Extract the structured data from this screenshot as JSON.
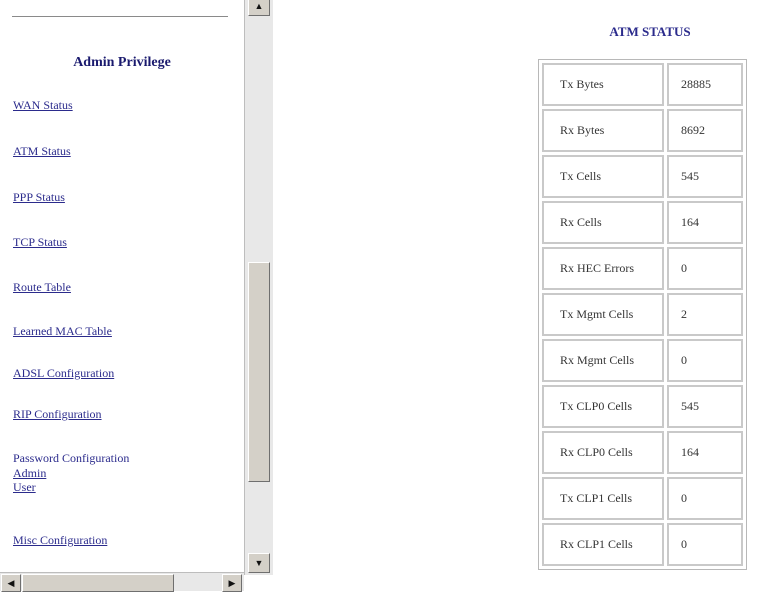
{
  "menu": {
    "title": "Admin Privilege",
    "links": [
      {
        "id": "wan",
        "label": "WAN Status"
      },
      {
        "id": "atm",
        "label": "ATM Status"
      },
      {
        "id": "ppp",
        "label": "PPP Status"
      },
      {
        "id": "tcp",
        "label": "TCP Status"
      },
      {
        "id": "route",
        "label": "Route Table"
      },
      {
        "id": "mac",
        "label": "Learned MAC Table"
      },
      {
        "id": "adsl",
        "label": "ADSL Configuration"
      },
      {
        "id": "rip",
        "label": "RIP Configuration"
      }
    ],
    "password_config_label": "Password Configuration",
    "password_admin": "Admin",
    "password_user": "User",
    "misc_label": "Misc Configuration"
  },
  "scrollbars": {
    "up_arrow": "▲",
    "down_arrow": "▼",
    "left_arrow": "◀",
    "right_arrow": "▶"
  },
  "atm_status": {
    "title": "ATM STATUS",
    "rows": [
      {
        "label": "Tx Bytes",
        "value": "28885"
      },
      {
        "label": "Rx Bytes",
        "value": "8692"
      },
      {
        "label": "Tx Cells",
        "value": "545"
      },
      {
        "label": "Rx Cells",
        "value": "164"
      },
      {
        "label": "Rx HEC Errors",
        "value": "0"
      },
      {
        "label": "Tx Mgmt Cells",
        "value": "2"
      },
      {
        "label": "Rx Mgmt Cells",
        "value": "0"
      },
      {
        "label": "Tx CLP0 Cells",
        "value": "545"
      },
      {
        "label": "Rx CLP0 Cells",
        "value": "164"
      },
      {
        "label": "Tx CLP1 Cells",
        "value": "0"
      },
      {
        "label": "Rx CLP1 Cells",
        "value": "0"
      }
    ]
  }
}
